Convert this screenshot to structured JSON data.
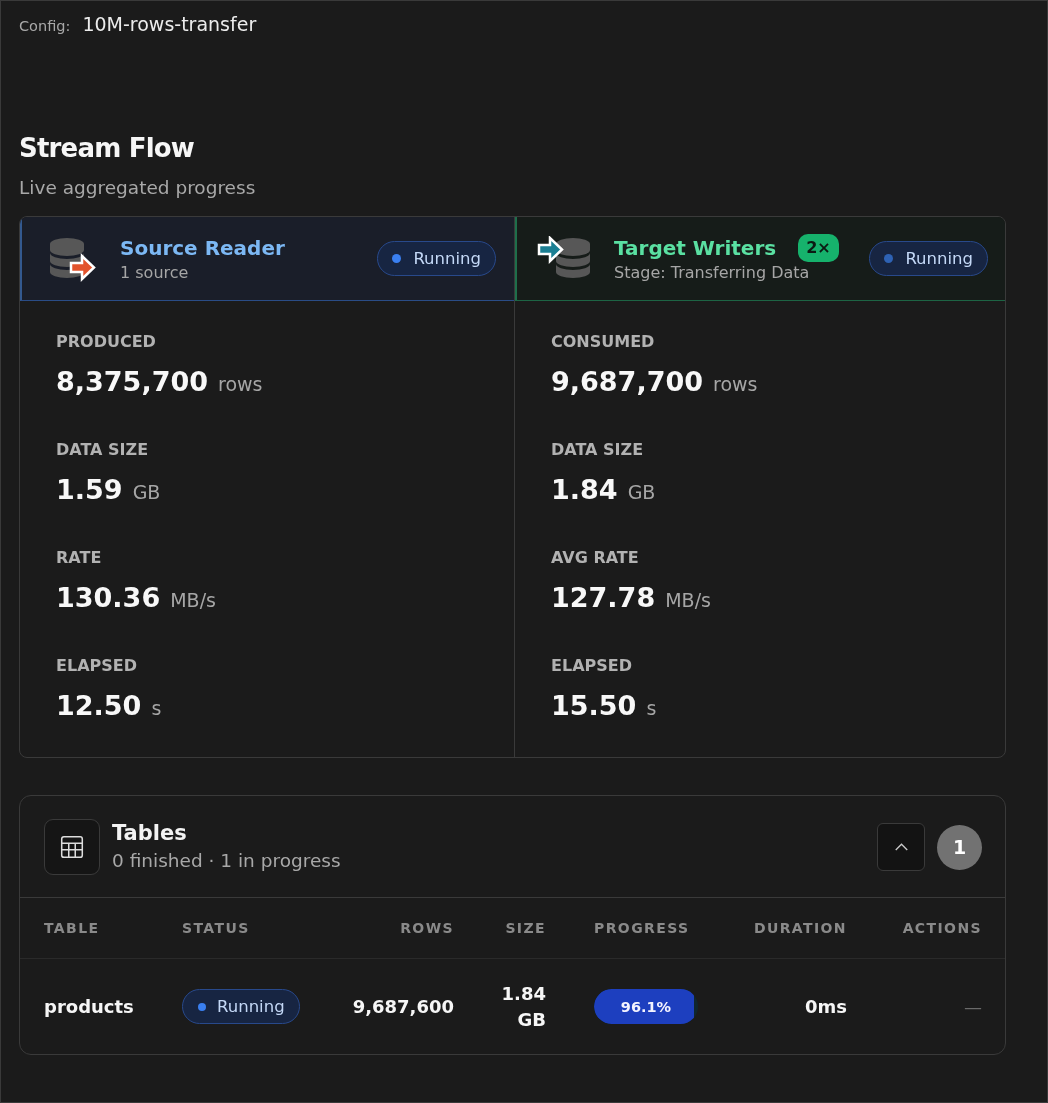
{
  "config": {
    "label": "Config:",
    "value": "10M-rows-transfer"
  },
  "stream_flow": {
    "title": "Stream Flow",
    "subtitle": "Live aggregated progress",
    "panels": [
      {
        "kind": "source",
        "title": "Source Reader",
        "subtitle": "1 source",
        "status": {
          "kind": "running",
          "label": "Running"
        },
        "stats": [
          {
            "label": "PRODUCED",
            "value": "8,375,700",
            "unit": "rows"
          },
          {
            "label": "DATA SIZE",
            "value": "1.59",
            "unit": "GB"
          },
          {
            "label": "RATE",
            "value": "130.36",
            "unit": "MB/s"
          },
          {
            "label": "ELAPSED",
            "value": "12.50",
            "unit": "s"
          }
        ]
      },
      {
        "kind": "target",
        "title": "Target Writers",
        "badge": "2×",
        "subtitle": "Stage: Transferring Data",
        "status": {
          "kind": "running",
          "label": "Running"
        },
        "stats": [
          {
            "label": "CONSUMED",
            "value": "9,687,700",
            "unit": "rows"
          },
          {
            "label": "DATA SIZE",
            "value": "1.84",
            "unit": "GB"
          },
          {
            "label": "AVG RATE",
            "value": "127.78",
            "unit": "MB/s"
          },
          {
            "label": "ELAPSED",
            "value": "15.50",
            "unit": "s"
          }
        ]
      }
    ]
  },
  "tables": {
    "title": "Tables",
    "subtitle": "0 finished · 1 in progress",
    "expanded": true,
    "count": "1",
    "columns": [
      "TABLE",
      "STATUS",
      "ROWS",
      "SIZE",
      "PROGRESS",
      "DURATION",
      "ACTIONS"
    ],
    "rows": [
      {
        "table": "products",
        "status": {
          "kind": "running",
          "label": "Running"
        },
        "rows": "9,687,600",
        "size": "1.84 GB",
        "progress": {
          "label": "96.1%",
          "level": 0.961
        },
        "duration": "0ms",
        "actions": "—"
      }
    ]
  }
}
